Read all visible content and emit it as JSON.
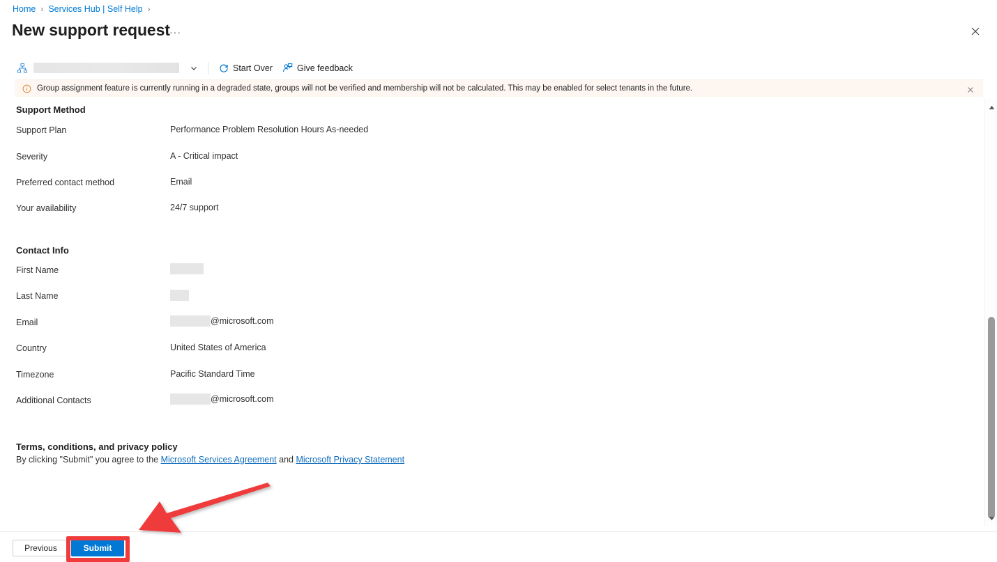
{
  "breadcrumb": {
    "items": [
      {
        "label": "Home",
        "icon": "none"
      },
      {
        "label": "Services Hub | Self Help",
        "icon": "none"
      }
    ],
    "separator": "›"
  },
  "header": {
    "title": "New support request",
    "more_ellipsis": "···",
    "close_icon": "close-icon"
  },
  "commandbar": {
    "hierarchy_icon": "hierarchy-icon",
    "selector_value": "",
    "chevron_icon": "chevron-down-icon",
    "buttons": [
      {
        "label": "Start Over",
        "icon": "refresh-icon"
      },
      {
        "label": "Give feedback",
        "icon": "feedback-person-icon"
      }
    ]
  },
  "banner": {
    "icon": "info-circle-icon",
    "message": "Group assignment feature is currently running in a degraded state, groups will not be verified and membership will not be calculated. This may be enabled for select tenants in the future.",
    "dismiss_icon": "close-icon",
    "background_color": "#fdf6f1",
    "icon_color": "#d88b39"
  },
  "support_method": {
    "heading": "Support Method",
    "rows": [
      {
        "label": "Support Plan",
        "value": "Performance Problem Resolution Hours As-needed",
        "redacted": false
      },
      {
        "label": "Severity",
        "value": "A - Critical impact",
        "redacted": false
      },
      {
        "label": "Preferred contact method",
        "value": "Email",
        "redacted": false
      },
      {
        "label": "Your availability",
        "value": "24/7 support",
        "redacted": false
      }
    ]
  },
  "contact_info": {
    "heading": "Contact Info",
    "rows": [
      {
        "label": "First Name",
        "value": "",
        "redacted": true,
        "redact_width": 48
      },
      {
        "label": "Last Name",
        "value": "",
        "redacted": true,
        "redact_width": 27
      },
      {
        "label": "Email",
        "value": "@microsoft.com",
        "redacted": true,
        "redact_width": 58
      },
      {
        "label": "Country",
        "value": "United States of America",
        "redacted": false
      },
      {
        "label": "Timezone",
        "value": "Pacific Standard Time",
        "redacted": false
      },
      {
        "label": "Additional Contacts",
        "value": "@microsoft.com",
        "redacted": true,
        "redact_width": 58
      }
    ]
  },
  "terms": {
    "heading": "Terms, conditions, and privacy policy",
    "prefix": "By clicking \"Submit\" you agree to the ",
    "link1": "Microsoft Services Agreement",
    "middle": " and ",
    "link2": "Microsoft Privacy Statement"
  },
  "footer": {
    "previous_label": "Previous",
    "submit_label": "Submit",
    "submit_color": "#0078d4"
  },
  "annotation": {
    "color": "#ef3b3b",
    "highlight_target": "submit-button",
    "arrow_direction": "points-left-down-to-submit"
  },
  "scrollbar": {
    "up_arrow_icon": "caret-up-icon",
    "down_arrow_icon": "caret-down-icon",
    "thumb": "scroll-thumb"
  }
}
